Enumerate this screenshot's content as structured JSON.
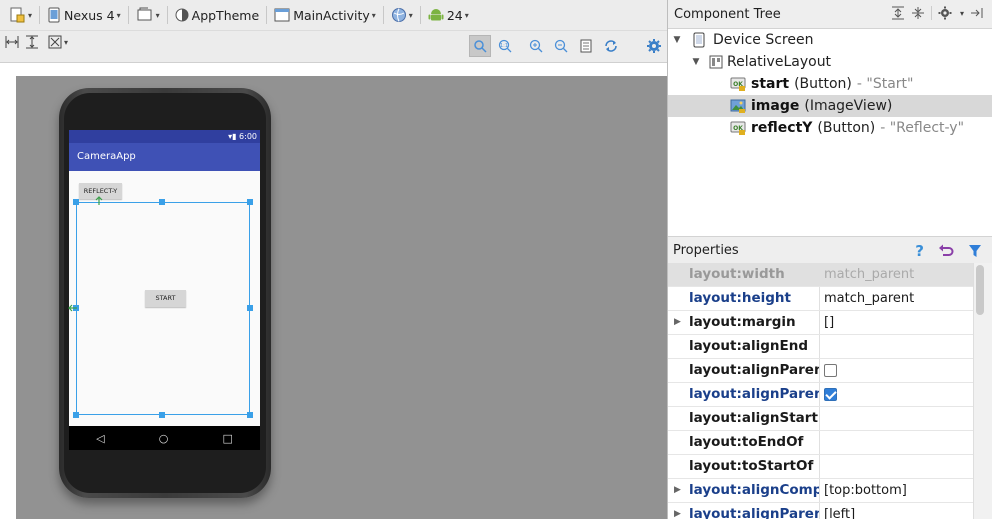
{
  "toolbar": {
    "device": "Nexus 4",
    "theme": "AppTheme",
    "activity": "MainActivity",
    "api": "24"
  },
  "phone": {
    "status_time": "6:00",
    "app_title": "CameraApp",
    "reflect_button": "REFLECT-Y",
    "start_button": "START",
    "nav_back": "◁",
    "nav_home": "○",
    "nav_recent": "□"
  },
  "component_tree": {
    "title": "Component Tree",
    "items": [
      {
        "name": "Device Screen",
        "type": "",
        "value": ""
      },
      {
        "name": "RelativeLayout",
        "type": "",
        "value": ""
      },
      {
        "name": "start",
        "type": "(Button)",
        "value": "- \"Start\""
      },
      {
        "name": "image",
        "type": "(ImageView)",
        "value": ""
      },
      {
        "name": "reflectY",
        "type": "(Button)",
        "value": "- \"Reflect-y\""
      }
    ]
  },
  "properties": {
    "title": "Properties",
    "rows": [
      {
        "name": "layout:width",
        "value": "match_parent"
      },
      {
        "name": "layout:height",
        "value": "match_parent"
      },
      {
        "name": "layout:margin",
        "value": "[]"
      },
      {
        "name": "layout:alignEnd",
        "value": ""
      },
      {
        "name": "layout:alignParentEnd",
        "value": ""
      },
      {
        "name": "layout:alignParentBottom",
        "value": ""
      },
      {
        "name": "layout:alignStart",
        "value": ""
      },
      {
        "name": "layout:toEndOf",
        "value": ""
      },
      {
        "name": "layout:toStartOf",
        "value": ""
      },
      {
        "name": "layout:alignComponent",
        "value": "[top:bottom]"
      },
      {
        "name": "layout:alignParent",
        "value": "[left]"
      }
    ]
  },
  "colors": {
    "accent_blue": "#3aa0e8",
    "appbar": "#3f51b5",
    "statusbar": "#303f9f",
    "canvas_gray": "#929292"
  }
}
